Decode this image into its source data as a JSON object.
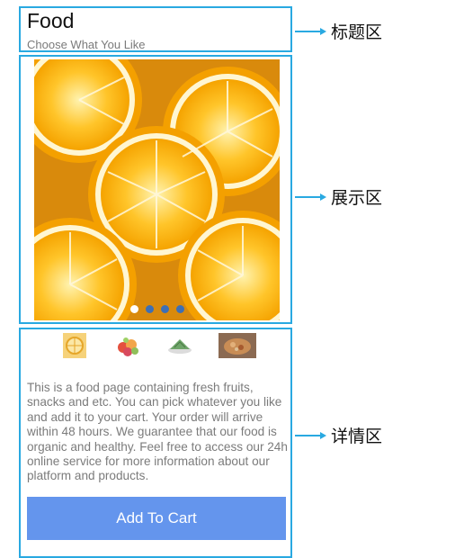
{
  "header": {
    "title": "Food",
    "subtitle": "Choose What You Like"
  },
  "carousel": {
    "slide_count": 4,
    "active_slide": 1,
    "image": "orange-slices"
  },
  "thumbnails": [
    {
      "name": "fruit-thumbnail"
    },
    {
      "name": "snacks-thumbnail"
    },
    {
      "name": "dumpling-thumbnail"
    },
    {
      "name": "dish-thumbnail"
    }
  ],
  "details": {
    "description": "This is a food page containing fresh fruits, snacks and etc. You can pick whatever you like and add it to your cart. Your order will arrive within 48 hours. We guarantee that our food is organic and healthy. Feel free to access our 24h online service for more information about our platform and products.",
    "button_label": "Add To Cart"
  },
  "annotations": {
    "title_area": "标题区",
    "display_area": "展示区",
    "detail_area": "详情区"
  },
  "colors": {
    "outline": "#29a9e1",
    "button": "#6495ed",
    "dot": "#3d6fb5"
  }
}
